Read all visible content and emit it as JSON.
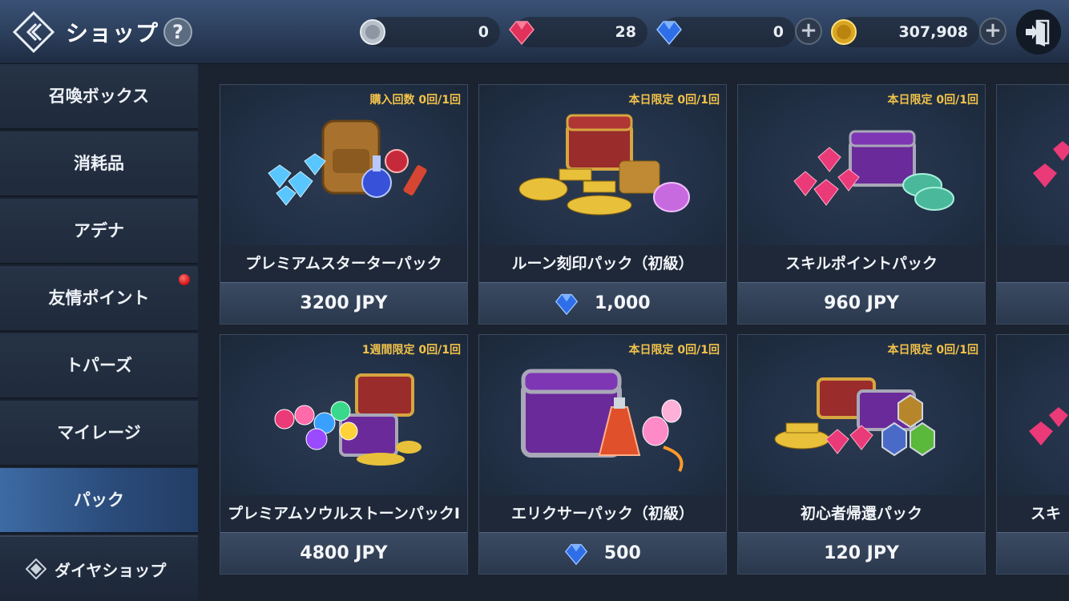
{
  "header": {
    "title": "ショップ",
    "help_label": "?",
    "currencies": [
      {
        "icon": "silver-coin-icon",
        "amount": "0",
        "has_plus": false
      },
      {
        "icon": "red-gem-icon",
        "amount": "28",
        "has_plus": false
      },
      {
        "icon": "blue-diamond-icon",
        "amount": "0",
        "has_plus": true
      },
      {
        "icon": "gold-coin-icon",
        "amount": "307,908",
        "has_plus": true
      }
    ],
    "plus_label": "+"
  },
  "sidebar": {
    "items": [
      {
        "label": "召喚ボックス"
      },
      {
        "label": "消耗品"
      },
      {
        "label": "アデナ"
      },
      {
        "label": "友情ポイント",
        "notification": true
      },
      {
        "label": "トパーズ"
      },
      {
        "label": "マイレージ"
      },
      {
        "label": "パック",
        "active": true
      }
    ],
    "diamond_shop_label": "ダイヤショップ"
  },
  "products": [
    {
      "limit": "購入回数 0回/1回",
      "name": "プレミアムスターターパック",
      "price": "3200 JPY",
      "image": "backpack-gems-potions"
    },
    {
      "limit": "本日限定 0回/1回",
      "name": "ルーン刻印パック（初級）",
      "price": "1,000",
      "price_icon": "blue-diamond-icon",
      "image": "gold-treasure-chest"
    },
    {
      "limit": "本日限定 0回/1回",
      "name": "スキルポイントパック",
      "price": "960 JPY",
      "image": "purple-chest-sp-coins"
    },
    {
      "limit": "",
      "name": "",
      "price": "",
      "image": "partial"
    },
    {
      "limit": "1週間限定 0回/1回",
      "name": "プレミアムソウルストーンパックⅠ",
      "price": "4800 JPY",
      "image": "soulstones-chest"
    },
    {
      "limit": "本日限定 0回/1回",
      "name": "エリクサーパック（初級）",
      "price": "500",
      "price_icon": "blue-diamond-icon",
      "image": "elixir-chest"
    },
    {
      "limit": "本日限定 0回/1回",
      "name": "初心者帰還パック",
      "price": "120 JPY",
      "image": "returner-treasure"
    },
    {
      "limit": "",
      "name": "スキ",
      "price": "",
      "image": "partial"
    }
  ],
  "colors": {
    "accent_gold": "#f2c24a",
    "active_tab": "#3d6aa4",
    "background": "#1b2330"
  }
}
